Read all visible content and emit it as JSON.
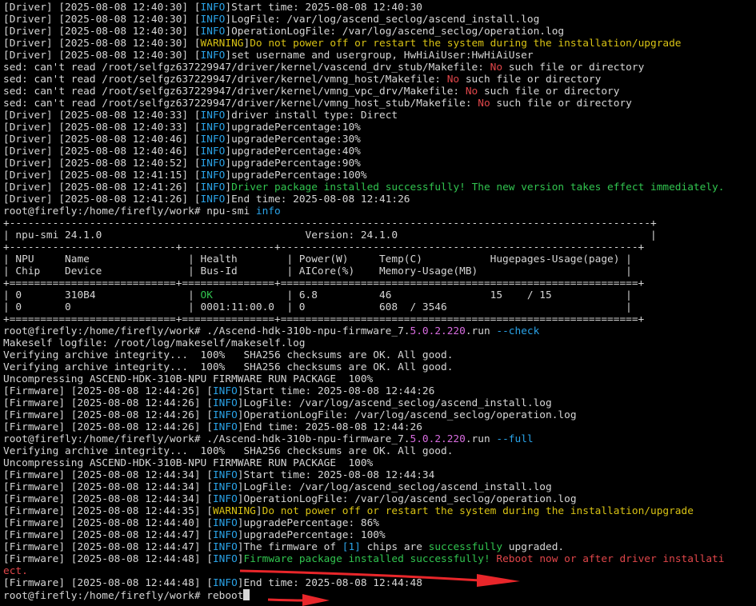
{
  "terminal": {
    "lines": [
      [
        [
          "[Driver] [2025-08-08 12:40:30] [",
          "white"
        ],
        [
          "INFO",
          "cyan"
        ],
        [
          "]Start time: 2025-08-08 12:40:30",
          "white"
        ]
      ],
      [
        [
          "[Driver] [2025-08-08 12:40:30] [",
          "white"
        ],
        [
          "INFO",
          "cyan"
        ],
        [
          "]LogFile: /var/log/ascend_seclog/ascend_install.log",
          "white"
        ]
      ],
      [
        [
          "[Driver] [2025-08-08 12:40:30] [",
          "white"
        ],
        [
          "INFO",
          "cyan"
        ],
        [
          "]OperationLogFile: /var/log/ascend_seclog/operation.log",
          "white"
        ]
      ],
      [
        [
          "[Driver] [2025-08-08 12:40:30] [",
          "white"
        ],
        [
          "WARNING",
          "yellow"
        ],
        [
          "]",
          "white"
        ],
        [
          "Do not power off or restart the system during the installation/upgrade",
          "yellow"
        ]
      ],
      [
        [
          "[Driver] [2025-08-08 12:40:30] [",
          "white"
        ],
        [
          "INFO",
          "cyan"
        ],
        [
          "]set username and usergroup, HwHiAiUser:HwHiAiUser",
          "white"
        ]
      ],
      [
        [
          "sed: can't read /root/selfgz637229947/driver/kernel/vascend_drv_stub/Makefile: ",
          "white"
        ],
        [
          "No",
          "red"
        ],
        [
          " such file or directory",
          "white"
        ]
      ],
      [
        [
          "sed: can't read /root/selfgz637229947/driver/kernel/vmng_host/Makefile: ",
          "white"
        ],
        [
          "No",
          "red"
        ],
        [
          " such file or directory",
          "white"
        ]
      ],
      [
        [
          "sed: can't read /root/selfgz637229947/driver/kernel/vmng_vpc_drv/Makefile: ",
          "white"
        ],
        [
          "No",
          "red"
        ],
        [
          " such file or directory",
          "white"
        ]
      ],
      [
        [
          "sed: can't read /root/selfgz637229947/driver/kernel/vmng_host_stub/Makefile: ",
          "white"
        ],
        [
          "No",
          "red"
        ],
        [
          " such file or directory",
          "white"
        ]
      ],
      [
        [
          "[Driver] [2025-08-08 12:40:33] [",
          "white"
        ],
        [
          "INFO",
          "cyan"
        ],
        [
          "]driver install type: Direct",
          "white"
        ]
      ],
      [
        [
          "[Driver] [2025-08-08 12:40:33] [",
          "white"
        ],
        [
          "INFO",
          "cyan"
        ],
        [
          "]upgradePercentage:10%",
          "white"
        ]
      ],
      [
        [
          "[Driver] [2025-08-08 12:40:46] [",
          "white"
        ],
        [
          "INFO",
          "cyan"
        ],
        [
          "]upgradePercentage:30%",
          "white"
        ]
      ],
      [
        [
          "[Driver] [2025-08-08 12:40:46] [",
          "white"
        ],
        [
          "INFO",
          "cyan"
        ],
        [
          "]upgradePercentage:40%",
          "white"
        ]
      ],
      [
        [
          "[Driver] [2025-08-08 12:40:52] [",
          "white"
        ],
        [
          "INFO",
          "cyan"
        ],
        [
          "]upgradePercentage:90%",
          "white"
        ]
      ],
      [
        [
          "[Driver] [2025-08-08 12:41:15] [",
          "white"
        ],
        [
          "INFO",
          "cyan"
        ],
        [
          "]upgradePercentage:100%",
          "white"
        ]
      ],
      [
        [
          "[Driver] [2025-08-08 12:41:26] [",
          "white"
        ],
        [
          "INFO",
          "cyan"
        ],
        [
          "]",
          "white"
        ],
        [
          "Driver package installed successfully! The new version takes effect immediately.",
          "green"
        ]
      ],
      [
        [
          "[Driver] [2025-08-08 12:41:26] [",
          "white"
        ],
        [
          "INFO",
          "cyan"
        ],
        [
          "]End time: 2025-08-08 12:41:26",
          "white"
        ]
      ],
      [
        [
          "root@firefly:/home/firefly/work# npu-smi ",
          "white"
        ],
        [
          "info",
          "cyan"
        ]
      ],
      [
        [
          "+--------------------------------------------------------------------------------------------------------+",
          "white"
        ]
      ],
      [
        [
          "| npu-smi 24.1.0                                 Version: 24.1.0                                         |",
          "white"
        ]
      ],
      [
        [
          "+---------------------------+---------------+----------------------------------------------------------+",
          "white"
        ]
      ],
      [
        [
          "| NPU     Name                | Health        | Power(W)     Temp(C)           Hugepages-Usage(page) |",
          "white"
        ]
      ],
      [
        [
          "| Chip    Device              | Bus-Id        | AICore(%)    Memory-Usage(MB)                        |",
          "white"
        ]
      ],
      [
        [
          "+===========================+===============+==========================================================+",
          "white"
        ]
      ],
      [
        [
          "| 0       310B4               | ",
          "white"
        ],
        [
          "OK",
          "green"
        ],
        [
          "            | 6.8          46                15    / 15            |",
          "white"
        ]
      ],
      [
        [
          "| 0       0                   | 0001:11:00.0  | 0            608  / 3546                             |",
          "white"
        ]
      ],
      [
        [
          "+===========================+===============+==========================================================+",
          "white"
        ]
      ],
      [
        [
          "root@firefly:/home/firefly/work# ./Ascend-hdk-310b-npu-firmware_7.",
          "white"
        ],
        [
          "5.0.2.220",
          "magenta"
        ],
        [
          ".run ",
          "white"
        ],
        [
          "--check",
          "cyan"
        ]
      ],
      [
        [
          "Makeself logfile: /root/log/makeself/makeself.log",
          "white"
        ]
      ],
      [
        [
          "Verifying archive integrity...  100%   SHA256 checksums are OK. All good.",
          "white"
        ]
      ],
      [
        [
          "Verifying archive integrity...  100%   SHA256 checksums are OK. All good.",
          "white"
        ]
      ],
      [
        [
          "Uncompressing ASCEND-HDK-310B-NPU FIRMWARE RUN PACKAGE  100%",
          "white"
        ]
      ],
      [
        [
          "[Firmware] [2025-08-08 12:44:26] [",
          "white"
        ],
        [
          "INFO",
          "cyan"
        ],
        [
          "]Start time: 2025-08-08 12:44:26",
          "white"
        ]
      ],
      [
        [
          "[Firmware] [2025-08-08 12:44:26] [",
          "white"
        ],
        [
          "INFO",
          "cyan"
        ],
        [
          "]LogFile: /var/log/ascend_seclog/ascend_install.log",
          "white"
        ]
      ],
      [
        [
          "[Firmware] [2025-08-08 12:44:26] [",
          "white"
        ],
        [
          "INFO",
          "cyan"
        ],
        [
          "]OperationLogFile: /var/log/ascend_seclog/operation.log",
          "white"
        ]
      ],
      [
        [
          "[Firmware] [2025-08-08 12:44:26] [",
          "white"
        ],
        [
          "INFO",
          "cyan"
        ],
        [
          "]End time: 2025-08-08 12:44:26",
          "white"
        ]
      ],
      [
        [
          "root@firefly:/home/firefly/work# ./Ascend-hdk-310b-npu-firmware_7.",
          "white"
        ],
        [
          "5.0.2.220",
          "magenta"
        ],
        [
          ".run ",
          "white"
        ],
        [
          "--full",
          "cyan"
        ]
      ],
      [
        [
          "Verifying archive integrity...  100%   SHA256 checksums are OK. All good.",
          "white"
        ]
      ],
      [
        [
          "Uncompressing ASCEND-HDK-310B-NPU FIRMWARE RUN PACKAGE  100%",
          "white"
        ]
      ],
      [
        [
          "[Firmware] [2025-08-08 12:44:34] [",
          "white"
        ],
        [
          "INFO",
          "cyan"
        ],
        [
          "]Start time: 2025-08-08 12:44:34",
          "white"
        ]
      ],
      [
        [
          "[Firmware] [2025-08-08 12:44:34] [",
          "white"
        ],
        [
          "INFO",
          "cyan"
        ],
        [
          "]LogFile: /var/log/ascend_seclog/ascend_install.log",
          "white"
        ]
      ],
      [
        [
          "[Firmware] [2025-08-08 12:44:34] [",
          "white"
        ],
        [
          "INFO",
          "cyan"
        ],
        [
          "]OperationLogFile: /var/log/ascend_seclog/operation.log",
          "white"
        ]
      ],
      [
        [
          "[Firmware] [2025-08-08 12:44:35] [",
          "white"
        ],
        [
          "WARNING",
          "yellow"
        ],
        [
          "]",
          "white"
        ],
        [
          "Do not power off or restart the system during the installation/upgrade",
          "yellow"
        ]
      ],
      [
        [
          "[Firmware] [2025-08-08 12:44:40] [",
          "white"
        ],
        [
          "INFO",
          "cyan"
        ],
        [
          "]upgradePercentage: 86%",
          "white"
        ]
      ],
      [
        [
          "[Firmware] [2025-08-08 12:44:47] [",
          "white"
        ],
        [
          "INFO",
          "cyan"
        ],
        [
          "]upgradePercentage: 100%",
          "white"
        ]
      ],
      [
        [
          "[Firmware] [2025-08-08 12:44:47] [",
          "white"
        ],
        [
          "INFO",
          "cyan"
        ],
        [
          "]The firmware of ",
          "white"
        ],
        [
          "[1]",
          "cyan"
        ],
        [
          " chips are ",
          "white"
        ],
        [
          "successfully",
          "green"
        ],
        [
          " upgraded.",
          "white"
        ]
      ],
      [
        [
          "[Firmware] [2025-08-08 12:44:48] [",
          "white"
        ],
        [
          "INFO",
          "cyan"
        ],
        [
          "]",
          "white"
        ],
        [
          "Firmware package installed successfully! ",
          "green"
        ],
        [
          "Reboot now or after driver installati",
          "red"
        ]
      ],
      [
        [
          "ect.",
          "red"
        ]
      ],
      [
        [
          "[Firmware] [2025-08-08 12:44:48] [",
          "white"
        ],
        [
          "INFO",
          "cyan"
        ],
        [
          "]End time: 2025-08-08 12:44:48",
          "white"
        ]
      ],
      [
        [
          "root@firefly:/home/firefly/work# reboot",
          "white"
        ]
      ]
    ]
  },
  "colors": {
    "background": "#000000",
    "white": "#d6d6d6",
    "cyan": "#2aa3e8",
    "yellow": "#d8c214",
    "green": "#31c44f",
    "red": "#e0464a",
    "magenta": "#d86ce0",
    "annotation_arrow": "#e8262a"
  },
  "annotations": {
    "arrow_icon_1": "red-arrow-icon",
    "arrow_icon_2": "red-arrow-icon"
  }
}
